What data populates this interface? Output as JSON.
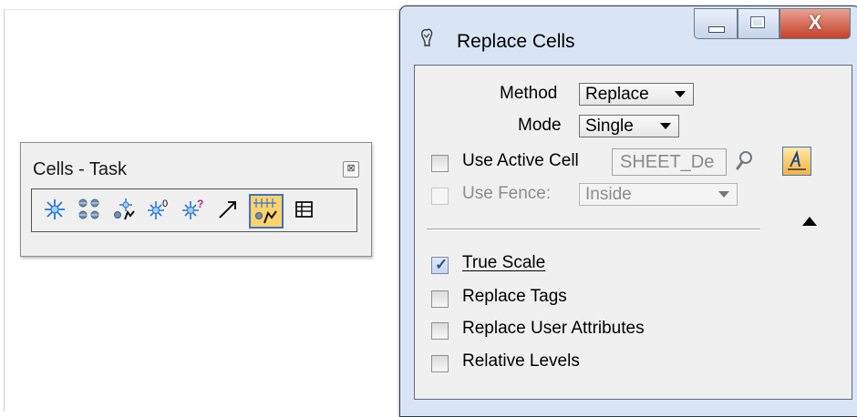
{
  "cells_toolbox": {
    "title": "Cells - Task",
    "close_glyph": "⊠",
    "tools": [
      {
        "name": "place-cell-icon",
        "active": false
      },
      {
        "name": "place-active-cell-matrix-icon",
        "active": false
      },
      {
        "name": "select-and-place-cell-icon",
        "active": false
      },
      {
        "name": "define-cell-origin-icon",
        "active": false
      },
      {
        "name": "identify-cell-icon",
        "active": false
      },
      {
        "name": "place-active-line-terminator-icon",
        "active": false
      },
      {
        "name": "replace-cells-icon",
        "active": true
      },
      {
        "name": "cell-library-icon",
        "active": false
      }
    ]
  },
  "replace_dialog": {
    "title": "Replace Cells",
    "close_glyph": "X",
    "method_label": "Method",
    "method_value": "Replace",
    "mode_label": "Mode",
    "mode_value": "Single",
    "use_active_cell_label": "Use Active Cell",
    "active_cell_value": "SHEET_De",
    "use_fence_label": "Use Fence:",
    "fence_mode_value": "Inside",
    "true_scale_label": "True Scale",
    "replace_tags_label": "Replace Tags",
    "replace_user_attributes_label": "Replace User Attributes",
    "relative_levels_label": "Relative Levels"
  },
  "state": {
    "use_active_cell": false,
    "use_fence": false,
    "true_scale": true,
    "replace_tags": false,
    "replace_user_attributes": false,
    "relative_levels": false
  },
  "colors": {
    "dialog_frame": "#d9e5f4",
    "close_button": "#c4402a",
    "active_tool_fill": "#ffd36b",
    "active_tool_border": "#3f71c6",
    "icon_blue": "#2a74d8"
  }
}
